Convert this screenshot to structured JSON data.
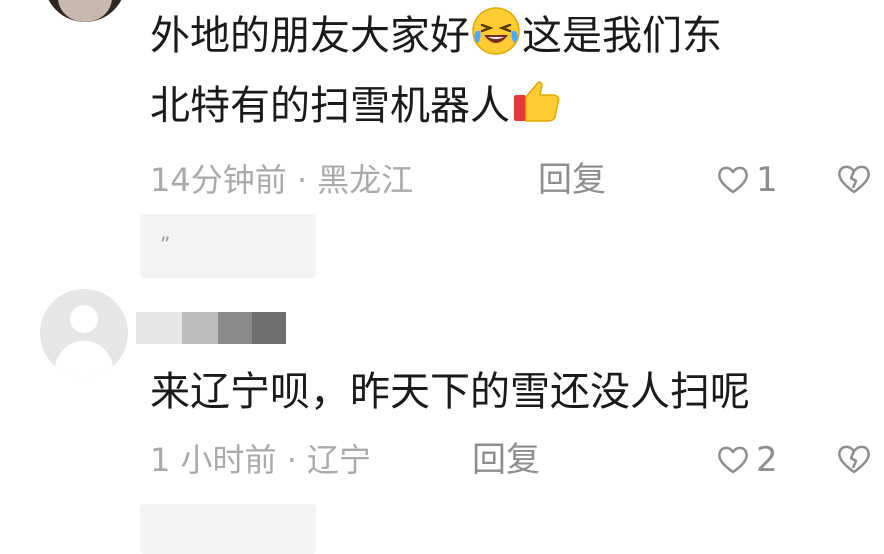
{
  "comments": [
    {
      "text_line1_a": "外地的朋友大家好",
      "text_line1_b": "这是我们东",
      "text_line2": "北特有的扫雪机器人",
      "emoji1": "grinning-squinting-face",
      "emoji2": "thumbs-up",
      "meta": "14分钟前 · 黑龙江",
      "reply_label": "回复",
      "likes": "1",
      "placeholder_mark": "„"
    },
    {
      "text": "来辽宁呗，昨天下的雪还没人扫呢",
      "meta": "1 小时前 · 辽宁",
      "reply_label": "回复",
      "likes": "2"
    }
  ],
  "colors": {
    "text": "#1a1a1a",
    "meta": "#aaaaaa",
    "icon": "#8e8e8e"
  },
  "icons": [
    "heart-outline-icon",
    "broken-heart-icon"
  ]
}
